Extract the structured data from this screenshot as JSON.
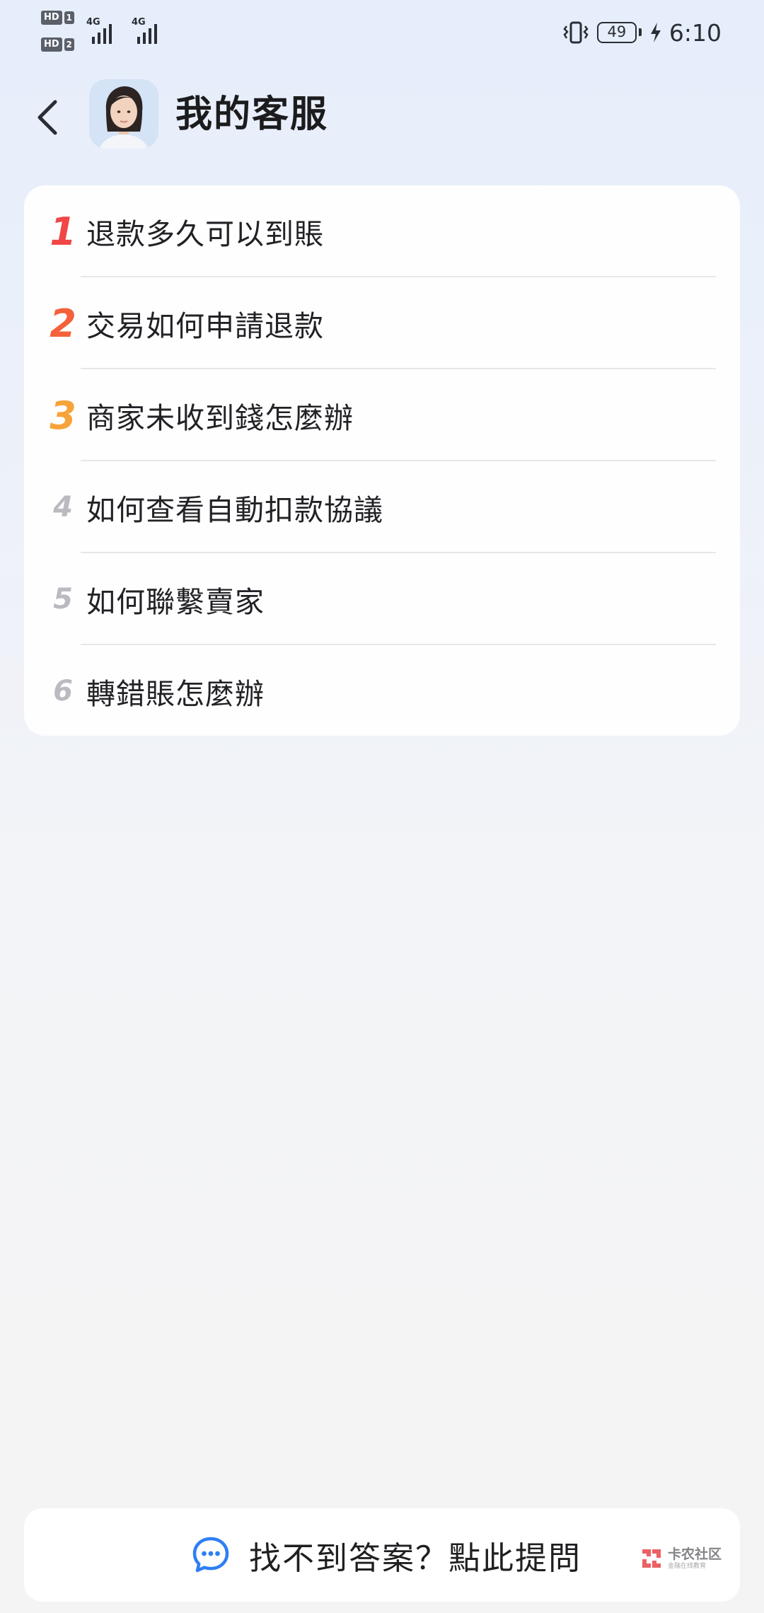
{
  "status_bar": {
    "sim1_label": "HD",
    "sim1_slot": "1",
    "sim2_label": "HD",
    "sim2_slot": "2",
    "network1": "4G",
    "network2": "4G",
    "battery_level": "49",
    "time": "6:10"
  },
  "header": {
    "back_icon": "chevron-left-icon",
    "title": "我的客服"
  },
  "faq": {
    "items": [
      {
        "rank": "1",
        "text": "退款多久可以到賬",
        "rank_color": "#f04646"
      },
      {
        "rank": "2",
        "text": "交易如何申請退款",
        "rank_color": "#f4613a"
      },
      {
        "rank": "3",
        "text": "商家未收到錢怎麼辦",
        "rank_color": "#f7a33a"
      },
      {
        "rank": "4",
        "text": "如何查看自動扣款協議",
        "rank_color": "#b9bbc0"
      },
      {
        "rank": "5",
        "text": "如何聯繫賣家",
        "rank_color": "#b9bbc0"
      },
      {
        "rank": "6",
        "text": "轉錯賬怎麼辦",
        "rank_color": "#b9bbc0"
      }
    ]
  },
  "bottom": {
    "ask_icon": "chat-bubble-icon",
    "ask_label": "找不到答案？點此提問",
    "accent": "#2f7ff3"
  },
  "watermark": {
    "title": "卡农社区",
    "subtitle": "金融在线教育"
  }
}
